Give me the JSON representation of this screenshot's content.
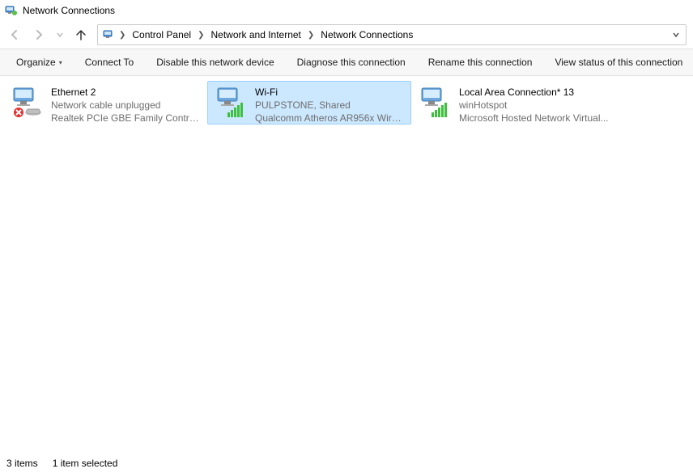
{
  "window": {
    "title": "Network Connections"
  },
  "breadcrumb": {
    "items": [
      "Control Panel",
      "Network and Internet",
      "Network Connections"
    ]
  },
  "commands": {
    "organize": "Organize",
    "connect_to": "Connect To",
    "disable": "Disable this network device",
    "diagnose": "Diagnose this connection",
    "rename": "Rename this connection",
    "view_status": "View status of this connection"
  },
  "connections": [
    {
      "name": "Ethernet 2",
      "status": "Network cable unplugged",
      "device": "Realtek PCIe GBE Family Controll...",
      "icon": "ethernet-disconnected",
      "selected": false
    },
    {
      "name": "Wi-Fi",
      "status": "PULPSTONE, Shared",
      "device": "Qualcomm Atheros AR956x Wirel...",
      "icon": "wifi-connected",
      "selected": true
    },
    {
      "name": "Local Area Connection* 13",
      "status": "winHotspot",
      "device": "Microsoft Hosted Network Virtual...",
      "icon": "wifi-connected",
      "selected": false
    }
  ],
  "statusbar": {
    "count": "3 items",
    "selection": "1 item selected"
  }
}
